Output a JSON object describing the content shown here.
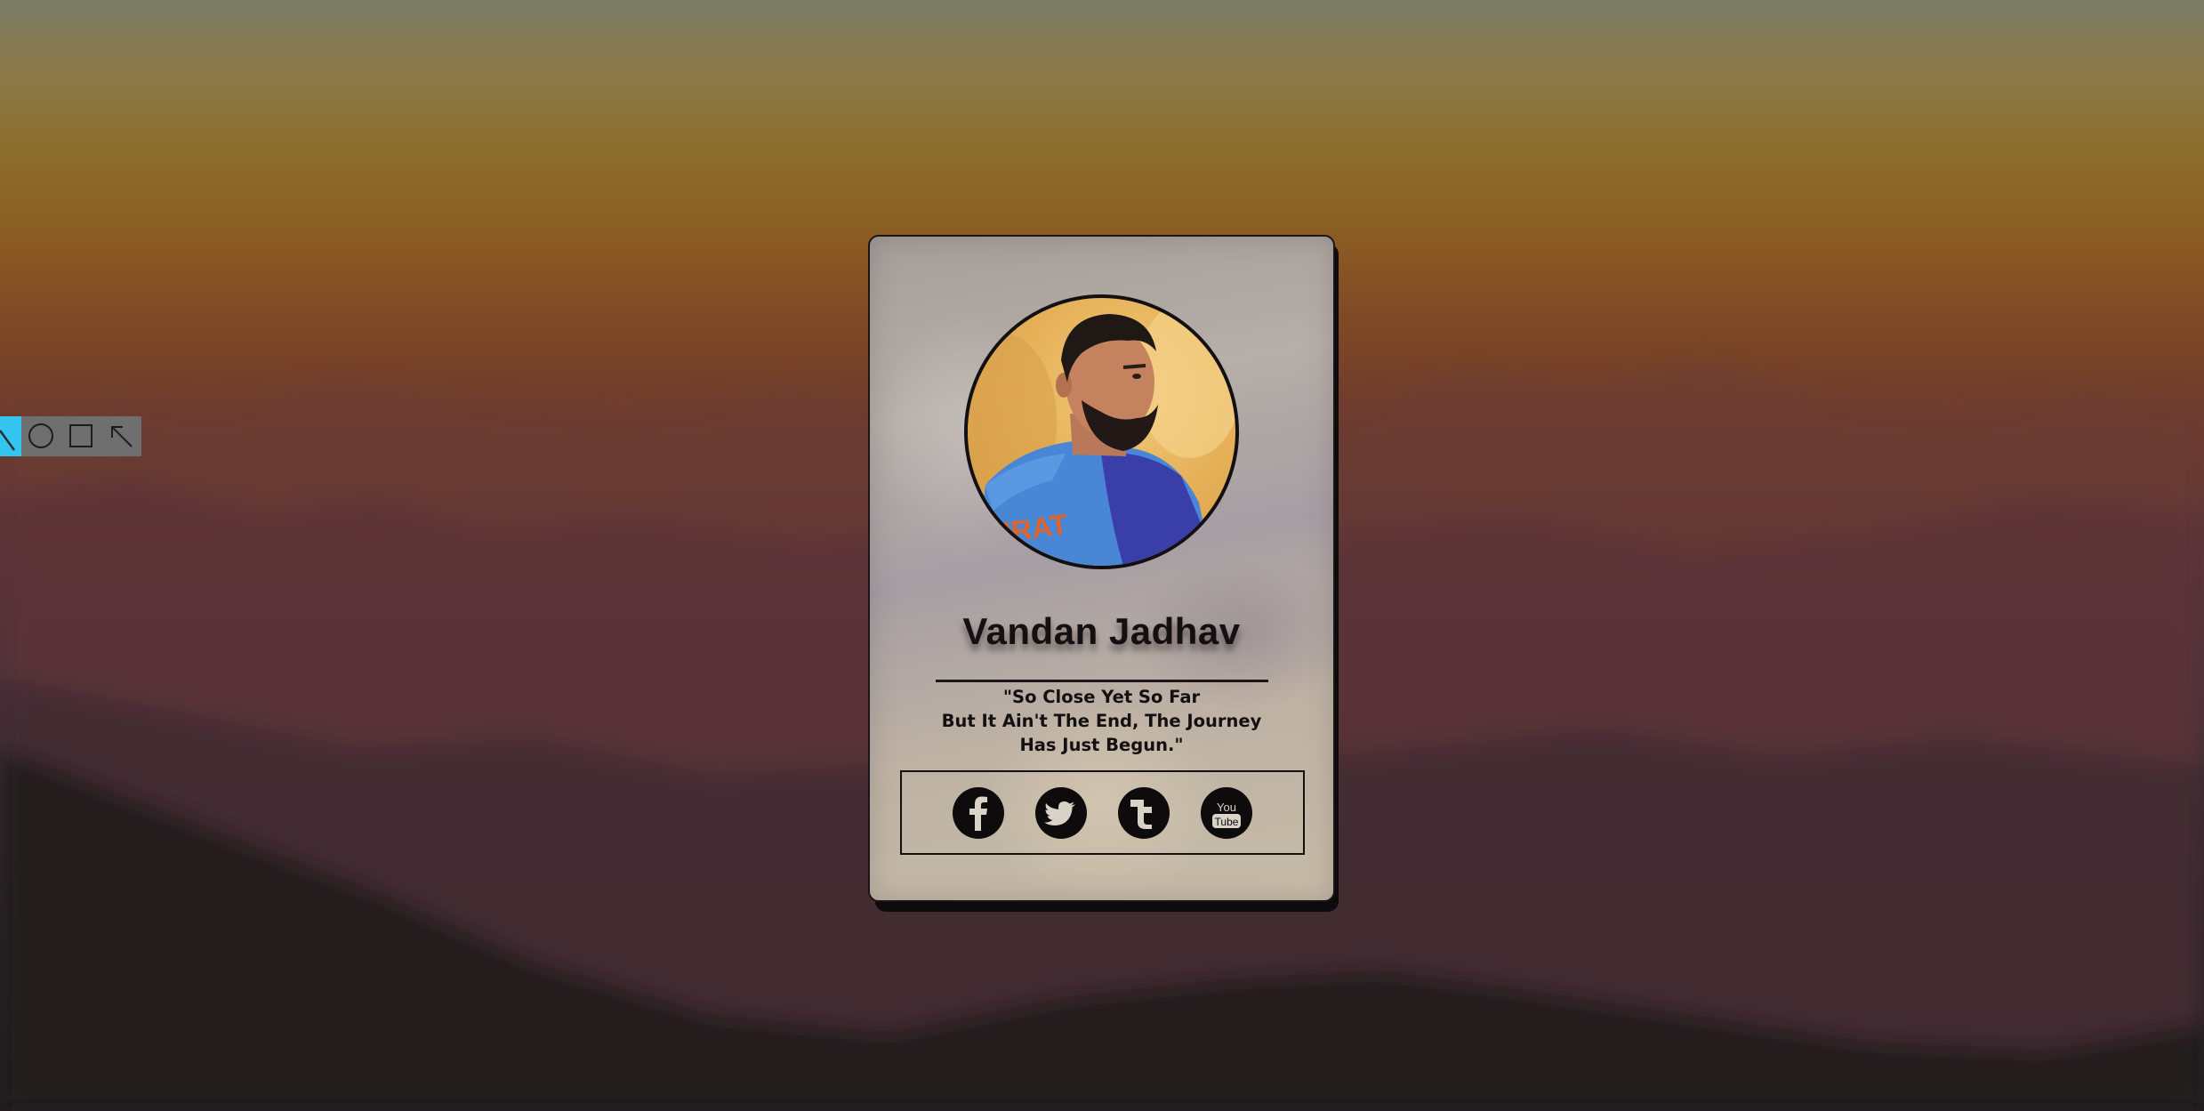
{
  "toolbar": {
    "tools": [
      {
        "icon": "line-tool-icon",
        "active": true
      },
      {
        "icon": "circle-tool-icon",
        "active": false
      },
      {
        "icon": "rectangle-tool-icon",
        "active": false
      },
      {
        "icon": "arrow-tool-icon",
        "active": false
      }
    ],
    "active_color": "#33c4f0"
  },
  "profile": {
    "name": "Vandan Jadhav",
    "quote_lines": [
      "\"So Close Yet So Far",
      "But It Ain't The End, The Journey",
      "Has Just Begun.\""
    ],
    "jersey_text": "IRAT"
  },
  "social": [
    {
      "name": "Facebook",
      "icon": "facebook-icon"
    },
    {
      "name": "Twitter",
      "icon": "twitter-icon"
    },
    {
      "name": "Tumblr",
      "icon": "tumblr-icon"
    },
    {
      "name": "YouTube",
      "icon": "youtube-icon",
      "glyph_top": "You",
      "glyph_bottom": "Tube"
    }
  ],
  "colors": {
    "card_border": "#1a1618",
    "text": "#141012",
    "icon_bg": "#0d0b0c"
  }
}
